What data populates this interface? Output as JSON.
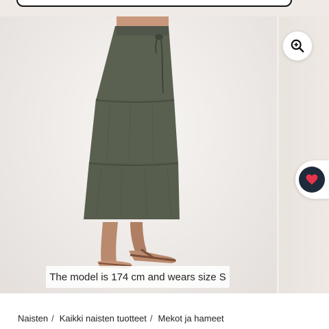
{
  "product": {
    "model_caption": "The model is 174 cm and wears size S",
    "image_count_visible": 2
  },
  "actions": {
    "zoom_icon": "zoom-in-icon",
    "wishlist_icon": "heart-icon"
  },
  "breadcrumb": {
    "items": [
      {
        "label": "Naisten"
      },
      {
        "label": "Kaikki naisten tuotteet"
      },
      {
        "label": "Mekot ja hameet"
      }
    ],
    "separator": "/"
  },
  "colors": {
    "skirt": "#5b6150",
    "wishlist_bg": "#1f2b3a",
    "heart": "#e8334a",
    "page_bg": "#ffffff"
  }
}
